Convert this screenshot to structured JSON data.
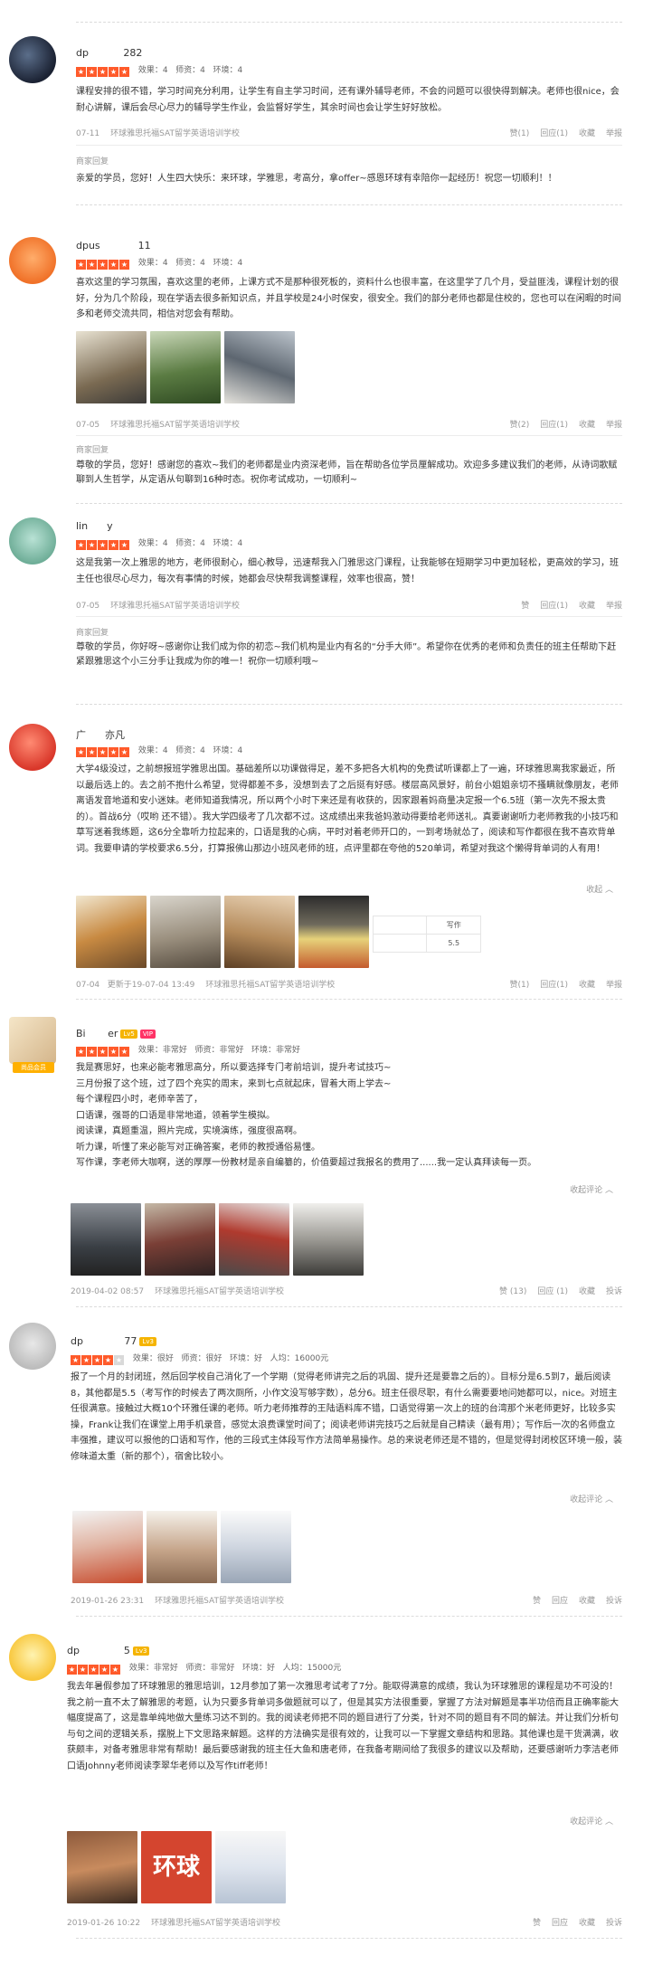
{
  "reviews": [
    {
      "username": "dp           282",
      "ratings": "效果：4   师资：4   环境：4",
      "content": "课程安排的很不错，学习时间充分利用，让学生有自主学习时间，还有课外辅导老师，不会的问题可以很快得到解决。老师也很nice，会耐心讲解，课后会尽心尽力的辅导学生作业，会监督好学生，其余时间也会让学生好好放松。",
      "date": "07-11",
      "shop": "环球雅思托福SAT留学英语培训学校",
      "actions": [
        "赞(1)",
        "回应(1)",
        "收藏",
        "举报"
      ],
      "merchant_label": "商家回复",
      "merchant_reply": "亲爱的学员，您好！人生四大快乐：来环球，学雅思，考高分，拿offer~感恩环球有幸陪你一起经历！祝您一切顺利！！"
    },
    {
      "username": "dpus            11",
      "ratings": "效果：4   师资：4   环境：4",
      "content": "喜欢这里的学习氛围，喜欢这里的老师，上课方式不是那种很死板的，资料什么也很丰富，在这里学了几个月，受益匪浅，课程计划的很好，分为几个阶段，现在学语去很多新知识点，并且学校是24小时保安，很安全。我们的部分老师也都是住校的，您也可以在闲暇的时间多和老师交流共同，相信对您会有帮助。",
      "date": "07-05",
      "shop": "环球雅思托福SAT留学英语培训学校",
      "actions": [
        "赞(2)",
        "回应(1)",
        "收藏",
        "举报"
      ],
      "merchant_label": "商家回复",
      "merchant_reply": "尊敬的学员，您好！感谢您的喜欢~我们的老师都是业内资深老师，旨在帮助各位学员厘解成功。欢迎多多建议我们的老师，从诗词歌赋聊到人生哲学，从定语从句聊到16种时态。祝你考试成功，一切顺利~"
    },
    {
      "username": "lin      y",
      "ratings": "效果：4   师资：4   环境：4",
      "content": "这是我第一次上雅思的地方，老师很耐心，细心教导，迅速帮我入门雅思这门课程，让我能够在短期学习中更加轻松，更高效的学习，班主任也很尽心尽力，每次有事情的时候，她都会尽快帮我调整课程，效率也很高，赞！",
      "date": "07-05",
      "shop": "环球雅思托福SAT留学英语培训学校",
      "actions": [
        "赞",
        "回应(1)",
        "收藏",
        "举报"
      ],
      "merchant_label": "商家回复",
      "merchant_reply": "尊敬的学员，你好呀~感谢你让我们成为你的初恋~我们机构是业内有名的“分手大师”。希望你在优秀的老师和负责任的班主任帮助下赶紧跟雅思这个小三分手让我成为你的唯一！祝你一切顺利哦~"
    },
    {
      "username": "广      亦凡",
      "ratings": "效果：4   师资：4   环境：4",
      "content": "大学4级没过，之前想报班学雅思出国。基础差所以功课做得足，差不多把各大机构的免费试听课都上了一遍，环球雅思离我家最近，所以最后选上的。去之前不抱什么希望，觉得都差不多，没想到去了之后挺有好感。楼层高风景好，前台小姐姐亲切不搔瞒就像朋友，老师离语发音地道和安小迷妹。老师知道我情况，所以两个小时下来还是有收获的，因家跟着妈商量决定报一个6.5班（第一次先不报太贵的）。首战6分（哎哟 还不错）。我大学四级考了几次都不过。这成绩出来我爸妈激动得要给老师送礼。真要谢谢听力老师教我的小技巧和草写迷着我练题，这6分全靠听力拉起来的，口语是我的心病，平时对着老师开口的，一到考场就怂了，阅读和写作都很在我不喜欢背单词。我要申请的学校要求6.5分，打算报佛山那边小班风老师的班，点评里都在夸他的520单词，希望对我这个懒得背单词的人有用！",
      "fold": "收起 ︿",
      "table": [
        [
          "",
          "写作"
        ],
        [
          "",
          "5.5"
        ]
      ],
      "date": "07-04   更新于19-07-04 13:49",
      "shop": "环球雅思托福SAT留学英语培训学校",
      "actions": [
        "赞(1)",
        "回应(1)",
        "收藏",
        "举报"
      ]
    },
    {
      "username": "Bi       er",
      "level": "Lv5",
      "vip": "VIP",
      "badge": "尚品会员",
      "ratings": "效果：非常好   师资：非常好   环境：非常好",
      "content_lines": [
        "我是赛思好，也来必能考雅思高分，所以要选择专门考前培训，提升考试技巧~",
        "三月份报了这个班，过了四个充实的周末，来到七点就起床，冒着大雨上学去~",
        "每个课程四小时，老师辛苦了，",
        "口语课，强哥的口语是非常地道，领着学生模拟。",
        "阅读课，真题重温，照片完成，实境演练，强度很高啊。",
        "听力课，听懂了来必能写对正确答案，老师的教授通俗易懂。",
        "写作课，李老师大咖啊，送的厚厚一份教材是亲自编纂的，价值要超过我报名的费用了......我一定认真拜读每一页。"
      ],
      "fold": "收起评论 ︿",
      "date": "2019-04-02 08:57",
      "shop": "环球雅思托福SAT留学英语培训学校",
      "actions": [
        "赞 (13)",
        "回应 (1)",
        "收藏",
        "投诉"
      ]
    },
    {
      "username": "dp             77",
      "level": "Lv3",
      "ratings": "效果：很好   师资：很好   环境：好   人均：16000元",
      "content": "报了一个月的封闭班，然后回学校自己消化了一个学期（觉得老师讲完之后的巩固、提升还是要靠之后的）。目标分是6.5到7，最后阅读8，其他都是5.5（考写作的时候去了两次厕所，小作文没写够字数），总分6。班主任很尽职，有什么需要要地问她都可以，nice。对班主任很满意。接触过大概10个环雅任课的老师。听力老师推荐的王陆语料库不错，口语觉得第一次上的班的台湾那个米老师更好，比较多实操，Frank让我们在课堂上用手机录音，感觉太浪费课堂时间了；阅读老师讲完技巧之后就是自己精读（最有用）；写作后一次的名师盘立丰强推，建议可以报他的口语和写作，他的三段式主体段写作方法简单易操作。总的来说老师还是不错的，但是觉得封闭校区环境一般，装修味道太重（新的那个），宿舍比较小。",
      "fold": "收起评论 ︿",
      "date": "2019-01-26 23:31",
      "shop": "环球雅思托福SAT留学英语培训学校",
      "actions": [
        "赞",
        "回应",
        "收藏",
        "投诉"
      ]
    },
    {
      "username": "dp              5",
      "level": "Lv3",
      "ratings": "效果：非常好   师资：非常好   环境：好   人均：15000元",
      "content": "我去年暑假参加了环球雅思的雅思培训，12月参加了第一次雅思考试考了7分。能取得满意的成绩，我认为环球雅思的课程是功不可没的！我之前一直不太了解雅思的考题，认为只要多背单词多做题就可以了，但是其实方法很重要，掌握了方法对解题是事半功倍而且正确率能大幅度提高了，这是靠单纯地做大量练习达不到的。我的阅读老师把不同的题目进行了分类，针对不同的题目有不同的解法。并让我们分析句与句之间的逻辑关系，摆脱上下文思路来解题。这样的方法确实是很有效的，让我可以一下掌握文章结构和思路。其他课也是干货满满，收获颇丰，对备考雅思非常有帮助！最后要感谢我的班主任大鱼和唐老师，在我备考期间给了我很多的建议以及帮助，还要感谢听力李洁老师口语Johnny老师阅读李翠华老师以及写作tiff老师！",
      "fold": "收起评论 ︿",
      "date": "2019-01-26 10:22",
      "shop": "环球雅思托福SAT留学英语培训学校",
      "actions": [
        "赞",
        "回应",
        "收藏",
        "投诉"
      ]
    }
  ]
}
